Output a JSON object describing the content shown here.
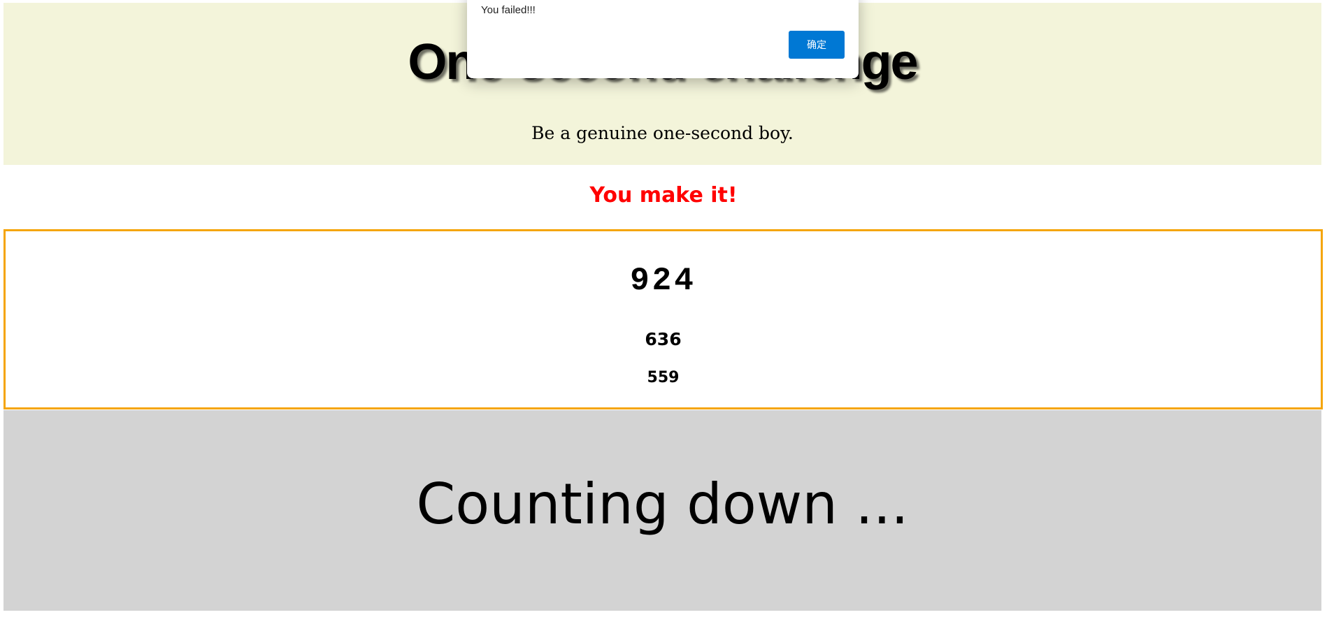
{
  "header": {
    "title": "One-second challenge",
    "subtitle": "Be a genuine one-second boy."
  },
  "result": {
    "message": "You make it!",
    "color": "#ff0000"
  },
  "times": {
    "current": "924",
    "previous": [
      "636",
      "559"
    ]
  },
  "countdown": {
    "label": "Counting down ..."
  },
  "alert_dialog": {
    "message": "You failed!!!",
    "ok_label": "确定",
    "ok_color": "#0078d4"
  },
  "colors": {
    "header_bg": "#f3f4da",
    "times_border": "#f5a50a",
    "countdown_bg": "#d3d3d3"
  }
}
